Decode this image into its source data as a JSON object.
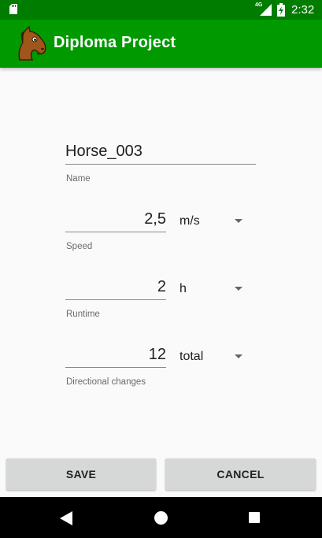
{
  "status_bar": {
    "network": "4G",
    "time": "2:32"
  },
  "app_bar": {
    "title": "Diploma Project"
  },
  "form": {
    "name": {
      "value": "Horse_003",
      "label": "Name"
    },
    "speed": {
      "value": "2,5",
      "unit": "m/s",
      "label": "Speed"
    },
    "runtime": {
      "value": "2",
      "unit": "h",
      "label": "Runtime"
    },
    "directional_changes": {
      "value": "12",
      "unit": "total",
      "label": "Directional changes"
    }
  },
  "actions": {
    "save_label": "SAVE",
    "cancel_label": "CANCEL"
  },
  "icons": {
    "status": [
      "sd-card-icon",
      "signal-icon",
      "battery-charging-icon"
    ],
    "nav": [
      "back-icon",
      "home-icon",
      "recents-icon"
    ],
    "logo": "horse-logo-icon"
  },
  "colors": {
    "status_bar": "#007d00",
    "app_bar": "#009a00",
    "background": "#fafafa",
    "button": "#d6d7d7"
  }
}
